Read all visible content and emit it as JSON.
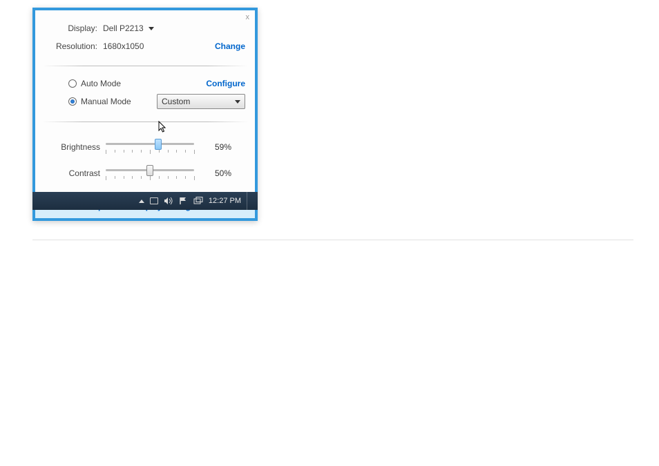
{
  "popup": {
    "close_label": "x",
    "display_label": "Display:",
    "display_value": "Dell P2213",
    "resolution_label": "Resolution:",
    "resolution_value": "1680x1050",
    "change_link": "Change",
    "auto_mode_label": "Auto Mode",
    "configure_link": "Configure",
    "manual_mode_label": "Manual Mode",
    "preset_selected": "Custom",
    "brightness_label": "Brightness",
    "brightness_value_pct": "59%",
    "brightness_value": 59,
    "contrast_label": "Contrast",
    "contrast_value_pct": "50%",
    "contrast_value": 50,
    "footer_link": "Open Dell Display Manager"
  },
  "taskbar": {
    "clock": "12:27 PM"
  }
}
